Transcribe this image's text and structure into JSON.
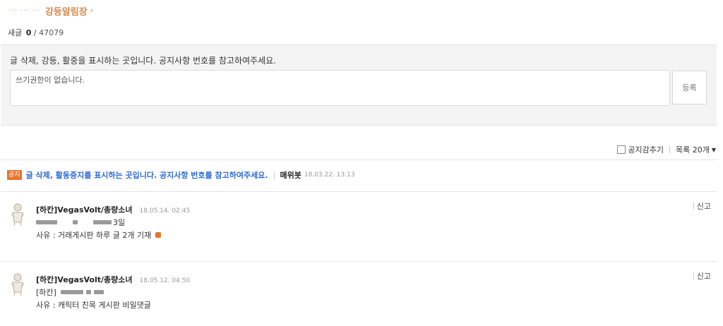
{
  "header": {
    "dots": "··· ··· ···",
    "title": "강등알림장"
  },
  "counter": {
    "label": "새글",
    "new": "0",
    "slash": "/",
    "total": "47079"
  },
  "write": {
    "notice": "글 삭제, 강등, 활중을 표시하는 곳입니다. 공지사항 번호를 참고하여주세요.",
    "input_text": "쓰기권한이 없습니다.",
    "submit_label": "등록"
  },
  "toolbar": {
    "hide_notice_label": "공지감추기",
    "list_size_label": "목록 20개"
  },
  "notice": {
    "badge": "공지",
    "text": "글 삭제, 활동중지를 표시하는 곳입니다. 공지사항 번호를 참고하여주세요.",
    "author": "매위봇",
    "date": "18.03.22. 13:13"
  },
  "comments": [
    {
      "author": "[하칸]VegasVolt/총량소녀",
      "date": "18.05.14. 02:45",
      "line2_suffix": "3일",
      "reason": "사유 : 거래게시판 하루 글 2개 기재",
      "report_label": "신고"
    },
    {
      "author": "[하칸]VegasVolt/총량소녀",
      "date": "18.05.12. 04:50",
      "line2_prefix": "[하칸]",
      "reason": "사유 : 캐릭터 친목 게시판 비밀댓글",
      "report_label": "신고"
    }
  ],
  "colors": {
    "accent": "#d8874b",
    "notice_blue": "#2e6bd4",
    "badge_orange": "#e6742b"
  }
}
